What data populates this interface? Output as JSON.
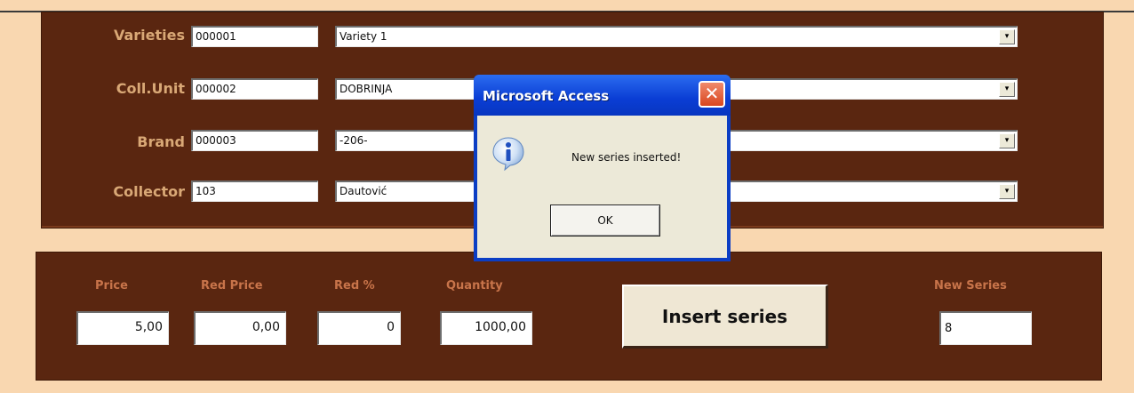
{
  "form": {
    "rows": [
      {
        "label": "Varieties",
        "code": "000001",
        "name": "Variety 1"
      },
      {
        "label": "Coll.Unit",
        "code": "000002",
        "name": "DOBRINJA"
      },
      {
        "label": "Brand",
        "code": "000003",
        "name": "-206-"
      },
      {
        "label": "Collector",
        "code": "103",
        "name": "Dautović"
      }
    ],
    "dropdown_arrow": "▾"
  },
  "pricing": {
    "price_label": "Price",
    "price_value": "5,00",
    "red_price_label": "Red Price",
    "red_price_value": "0,00",
    "red_pct_label": "Red %",
    "red_pct_value": "0",
    "quantity_label": "Quantity",
    "quantity_value": "1000,00",
    "insert_button": "Insert series",
    "new_series_label": "New Series",
    "new_series_value": "8"
  },
  "dialog": {
    "title": "Microsoft Access",
    "close": "✕",
    "message": "New series inserted!",
    "ok": "OK",
    "icon": "info-icon"
  },
  "colors": {
    "panel": "#5a2610",
    "background": "#f9d7b0",
    "label": "#d9a876",
    "column_label": "#c8744a",
    "dialog_title": "#0b3ec4"
  }
}
